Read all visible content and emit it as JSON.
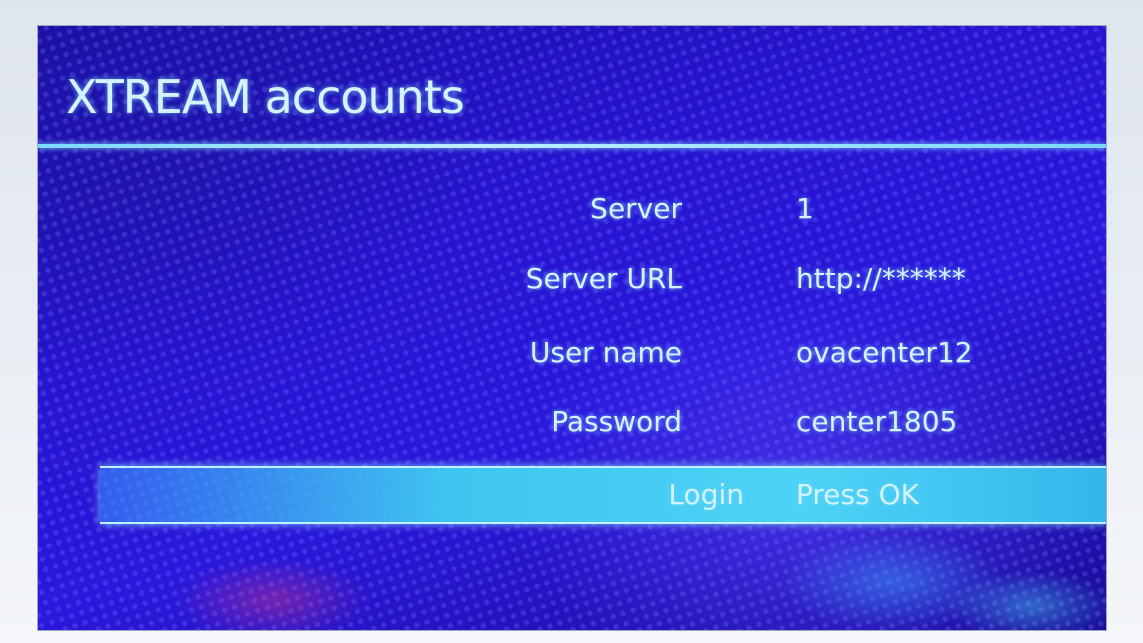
{
  "screen": {
    "title": "XTREAM accounts"
  },
  "form": {
    "rows": [
      {
        "label": "Server",
        "value": "1"
      },
      {
        "label": "Server URL",
        "value": "http://******"
      },
      {
        "label": "User name",
        "value": "ovacenter12"
      },
      {
        "label": "Password",
        "value": "center1805"
      },
      {
        "label": "Login",
        "value": "Press OK"
      }
    ]
  },
  "colors": {
    "background": "#2614d0",
    "text": "#d6f2ff",
    "highlight": "#3ec6f0"
  }
}
